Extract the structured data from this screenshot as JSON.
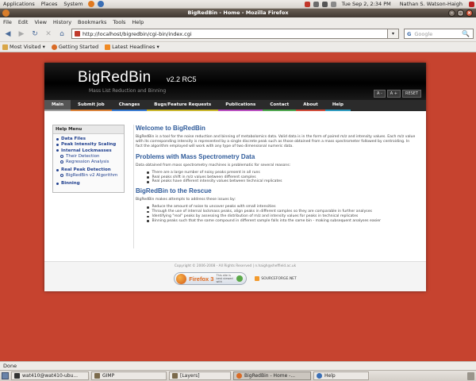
{
  "gnome_panel": {
    "menus": [
      "Applications",
      "Places",
      "System"
    ],
    "clock": "Tue Sep  2,  2:34 PM",
    "user": "Nathan S. Watson-Haigh"
  },
  "window": {
    "title": "BigRedBin - Home - Mozilla Firefox"
  },
  "menubar": {
    "items": [
      "File",
      "Edit",
      "View",
      "History",
      "Bookmarks",
      "Tools",
      "Help"
    ]
  },
  "toolbar": {
    "back": "◀",
    "forward": "▶",
    "reload": "↻",
    "stop": "✕",
    "home": "⌂",
    "url": "http://localhost/bigredbin/cgi-bin/index.cgi",
    "url_dropdown": "▾",
    "search_placeholder": "Google",
    "search_engine_glyph": "G",
    "search_go": "🔍"
  },
  "bookmarks": {
    "items": [
      "Most Visited ▾",
      "Getting Started",
      "Latest Headlines ▾"
    ]
  },
  "site": {
    "title": "BigRedBin",
    "version": "v2.2 RC5",
    "tagline": "Mass List Reduction and Binning",
    "font_controls": [
      "A -",
      "A +",
      "RESET"
    ],
    "nav_tabs": [
      "Main",
      "Submit Job",
      "Changes",
      "Bugs/Feature Requests",
      "Publications",
      "Contact",
      "About",
      "Help"
    ],
    "help_menu": {
      "title": "Help Menu",
      "items": [
        "Data Files",
        "Peak Intensity Scaling",
        "Internal Lockmasses",
        "Their Detection",
        "Regression Analysis",
        "Real Peak Detection",
        "BigRedBin v2 Algorithm",
        "Binning"
      ]
    },
    "content": {
      "welcome_heading": "Welcome to BigRedBin",
      "intro": "BigRedBin is a tool for the noise reduction and binning of metabolomics data. Valid data is in the form of paired m/z and intensity values. Each m/z value with its corresponding intensity is represented by a single discrete peak such as those obtained from a mass spectrometer followed by centroiding. In fact the algorithm employed will work with any type of two dimensional numeric data.",
      "problems_heading": "Problems with Mass Spectrometry Data",
      "problems_intro": "Data obtained from mass spectrometry machines is problematic for several reasons:",
      "problems": [
        "There are a large number of noisy peaks present in all runs",
        "Real peaks shift in m/z values between different samples",
        "Real peaks have different intensity values between technical replicates"
      ],
      "rescue_heading": "BigRedBin to the Rescue",
      "rescue_intro": "BigRedBin makes attempts to address these issues by:",
      "rescue": [
        "Reduce the amount of noise to uncover peaks with small intensities",
        "Through the use of internal lockmass peaks, align peaks in different samples so they are comparable in further analyses",
        "Identifying \"real\" peaks by assessing the distribution of m/z and intensity values for peaks in technical replicates",
        "Binning peaks such that the same compound in different sample falls into the same bin - making subsequent analyses easier"
      ]
    },
    "footer": {
      "copyright": "Copyright © 2006-2008 - All Rights Reserved | n.haigh@sheffield.ac.uk",
      "firefox_badge": "Firefox 3",
      "firefox_sub": "This site is best viewed with",
      "sourceforge": "SOURCEFORGE.NET"
    }
  },
  "status_bar": {
    "text": "Done"
  },
  "task_panel": {
    "items": [
      "wat410@wat410-ubu...",
      "GIMP",
      "[Layers]",
      "BigRedBin - Home -...",
      "Help"
    ],
    "active_index": 3
  },
  "colors": {
    "page_background": "#c6432f",
    "heading_blue": "#2f5b9a",
    "firefox_orange": "#e06b1f"
  }
}
